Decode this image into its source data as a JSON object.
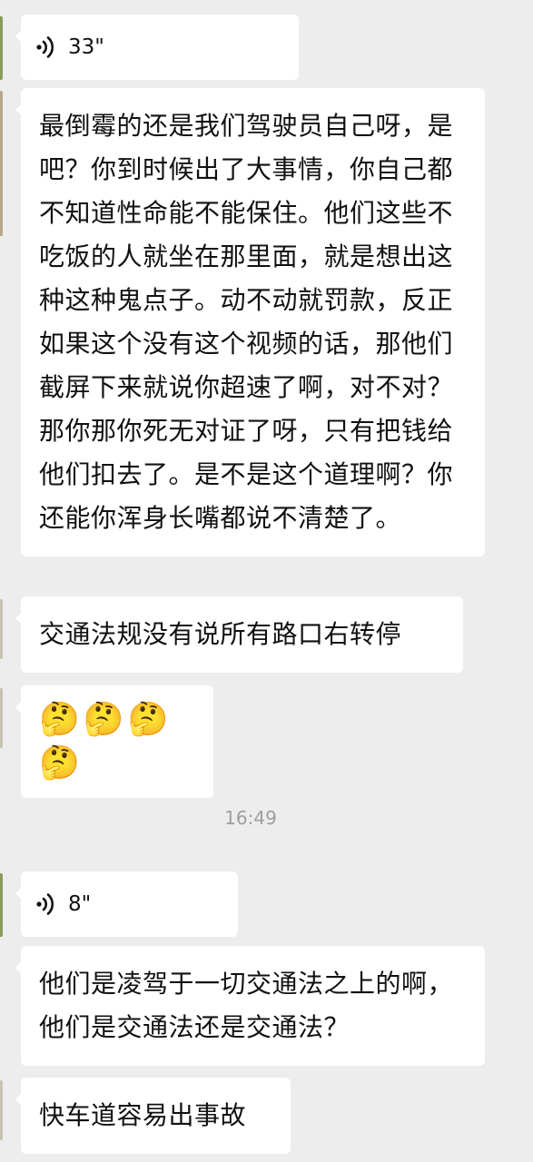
{
  "messages": [
    {
      "type": "voice",
      "duration": "33\""
    },
    {
      "type": "text",
      "text": "最倒霉的还是我们驾驶员自己呀，是吧？你到时候出了大事情，你自己都不知道性命能不能保住。他们这些不吃饭的人就坐在那里面，就是想出这种这种鬼点子。动不动就罚款，反正如果这个没有这个视频的话，那他们截屏下来就说你超速了啊，对不对？那你那你死无对证了呀，只有把钱给他们扣去了。是不是这个道理啊？你还能你浑身长嘴都说不清楚了。"
    },
    {
      "type": "text",
      "text": "交通法规没有说所有路口右转停"
    },
    {
      "type": "emoji",
      "text": "🤔🤔🤔🤔"
    },
    {
      "type": "timestamp",
      "text": "16:49"
    },
    {
      "type": "voice",
      "duration": "8\""
    },
    {
      "type": "text",
      "text": "他们是凌驾于一切交通法之上的啊，他们是交通法还是交通法？"
    },
    {
      "type": "text",
      "text": "快车道容易出事故"
    }
  ],
  "colors": {
    "background": "#ededed",
    "bubble": "#ffffff",
    "text": "#111111",
    "timestamp": "#9e9e9e"
  },
  "icons": {
    "voice": "voice-wave-icon"
  }
}
